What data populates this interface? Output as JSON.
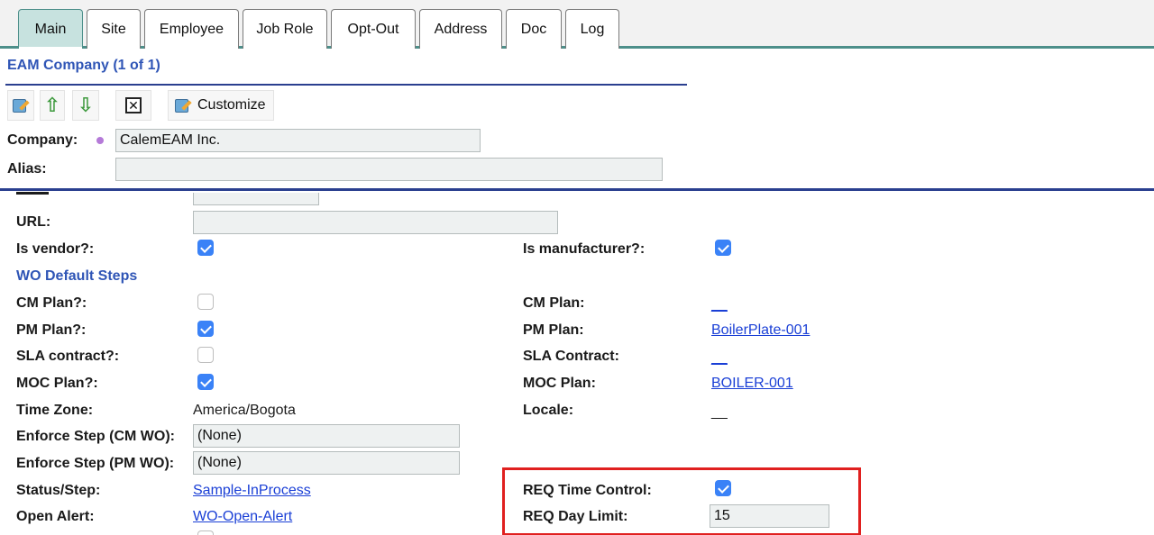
{
  "tabs": [
    {
      "label": "Main",
      "active": true
    },
    {
      "label": "Site",
      "active": false
    },
    {
      "label": "Employee",
      "active": false
    },
    {
      "label": "Job Role",
      "active": false
    },
    {
      "label": "Opt-Out",
      "active": false
    },
    {
      "label": "Address",
      "active": false
    },
    {
      "label": "Doc",
      "active": false
    },
    {
      "label": "Log",
      "active": false
    }
  ],
  "header": {
    "title": "EAM Company (1 of 1)"
  },
  "toolbar": {
    "edit_icon": "edit-icon",
    "up_icon": "arrow-up-icon",
    "down_icon": "arrow-down-icon",
    "delete_icon": "delete-icon",
    "customize_label": "Customize"
  },
  "company": {
    "label": "Company:",
    "value": "CalemEAM Inc."
  },
  "alias": {
    "label": "Alias:",
    "value": ""
  },
  "form": {
    "url": {
      "label": "URL:",
      "value": ""
    },
    "is_vendor": {
      "label": "Is vendor?:",
      "checked": true
    },
    "is_manufacturer": {
      "label": "Is manufacturer?:",
      "checked": true
    },
    "wo_default_steps": "WO Default Steps",
    "cm_plan_flag": {
      "label": "CM Plan?:",
      "checked": false
    },
    "cm_plan": {
      "label": "CM Plan:",
      "value": "__"
    },
    "pm_plan_flag": {
      "label": "PM Plan?:",
      "checked": true
    },
    "pm_plan": {
      "label": "PM Plan:",
      "value": "BoilerPlate-001"
    },
    "sla_contract_flag": {
      "label": "SLA contract?:",
      "checked": false
    },
    "sla_contract": {
      "label": "SLA Contract:",
      "value": "__"
    },
    "moc_plan_flag": {
      "label": "MOC Plan?:",
      "checked": true
    },
    "moc_plan": {
      "label": "MOC Plan:",
      "value": "BOILER-001"
    },
    "time_zone": {
      "label": "Time Zone:",
      "value": "America/Bogota"
    },
    "locale": {
      "label": "Locale:",
      "value": "__"
    },
    "enforce_step_cm": {
      "label": "Enforce Step (CM WO):",
      "value": "(None)"
    },
    "enforce_step_pm": {
      "label": "Enforce Step (PM WO):",
      "value": "(None)"
    },
    "status_step": {
      "label": "Status/Step:",
      "value": "Sample-InProcess"
    },
    "req_time_control": {
      "label": "REQ Time Control:",
      "checked": true
    },
    "open_alert": {
      "label": "Open Alert:",
      "value": "WO-Open-Alert"
    },
    "req_day_limit": {
      "label": "REQ Day Limit:",
      "value": "15"
    }
  },
  "colors": {
    "accent": "#4d8f8a",
    "link": "#1a3fd6",
    "section_title": "#2f55b6",
    "highlight": "#e0201f",
    "checkbox_checked": "#3a82f7"
  }
}
